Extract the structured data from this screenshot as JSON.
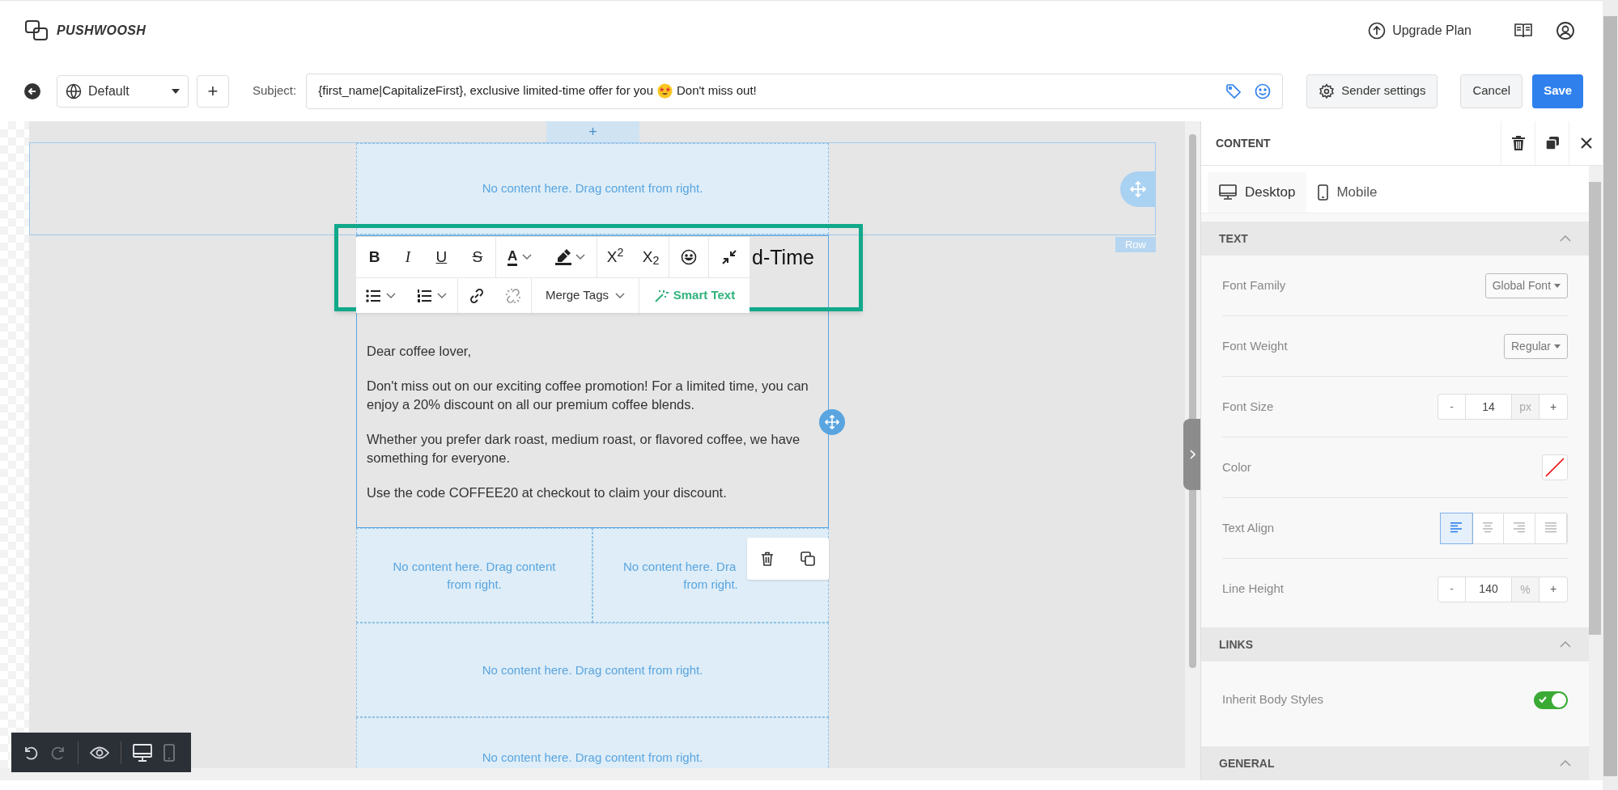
{
  "header": {
    "logo": "PUSHWOOSH",
    "upgrade": "Upgrade Plan"
  },
  "topbar": {
    "template": "Default",
    "add": "+",
    "subject_label": "Subject:",
    "subject_before": "{first_name|CapitalizeFirst}, exclusive limited-time offer for you",
    "subject_after": "Don't miss out!",
    "sender_settings": "Sender settings",
    "cancel": "Cancel",
    "save": "Save"
  },
  "canvas": {
    "add": "+",
    "top_placeholder": "No content here. Drag content from right.",
    "row_tag": "Row",
    "heading": "d-Time",
    "paragraphs": [
      "Dear coffee lover,",
      "Don't miss out on our exciting coffee promotion! For a limited time, you can enjoy a 20% discount on all our premium coffee blends.",
      "Whether you prefer dark roast, medium roast, or flavored coffee, we have something for everyone.",
      "Use the code COFFEE20 at checkout to claim your discount."
    ],
    "left_placeholder": "No content here. Drag content from right.",
    "right_placeholder_line1": "No content here. Dra",
    "right_placeholder_line2": "from right.",
    "placeholders": [
      "No content here. Drag content from right.",
      "No content here. Drag content from right."
    ]
  },
  "format_toolbar": {
    "bold": "B",
    "italic": "I",
    "underline": "U",
    "strike": "S",
    "font_color": "A",
    "superscript": "X$^{2}$",
    "subscript": "X$_{2}$",
    "merge_tags": "Merge Tags",
    "smart_text": "Smart Text"
  },
  "bottom_toolbar": {
    "history": [
      {
        "kind": "undo",
        "disabled": false
      },
      {
        "kind": "redo",
        "disabled": true
      }
    ],
    "views": [
      {
        "kind": "desktop",
        "selected": true
      },
      {
        "kind": "mobile",
        "selected": false
      }
    ]
  },
  "panel": {
    "title": "CONTENT",
    "tabs": [
      {
        "label": "Desktop",
        "kind": "desktop",
        "selected": true
      },
      {
        "label": "Mobile",
        "kind": "mobile",
        "selected": false
      }
    ],
    "sections": [
      {
        "title": "TEXT",
        "expanded": true,
        "rows": [
          {
            "kind": "select",
            "label": "Font Family",
            "value": "Global Font"
          },
          {
            "kind": "select",
            "label": "Font Weight",
            "value": "Regular"
          },
          {
            "kind": "stepper",
            "label": "Font Size",
            "minus": "-",
            "value": "14",
            "unit": "px",
            "plus": "+"
          },
          {
            "kind": "color",
            "label": "Color"
          },
          {
            "kind": "align",
            "label": "Text Align",
            "options": [
              {
                "kind": "left",
                "selected": true
              },
              {
                "kind": "center",
                "selected": false
              },
              {
                "kind": "right",
                "selected": false
              },
              {
                "kind": "justify",
                "selected": false
              }
            ]
          },
          {
            "kind": "stepper",
            "label": "Line Height",
            "minus": "-",
            "value": "140",
            "unit": "%",
            "plus": "+"
          }
        ]
      },
      {
        "title": "LINKS",
        "expanded": true,
        "rows": [
          {
            "kind": "toggle",
            "label": "Inherit Body Styles",
            "on": true
          }
        ]
      },
      {
        "title": "GENERAL",
        "expanded": true
      }
    ]
  }
}
